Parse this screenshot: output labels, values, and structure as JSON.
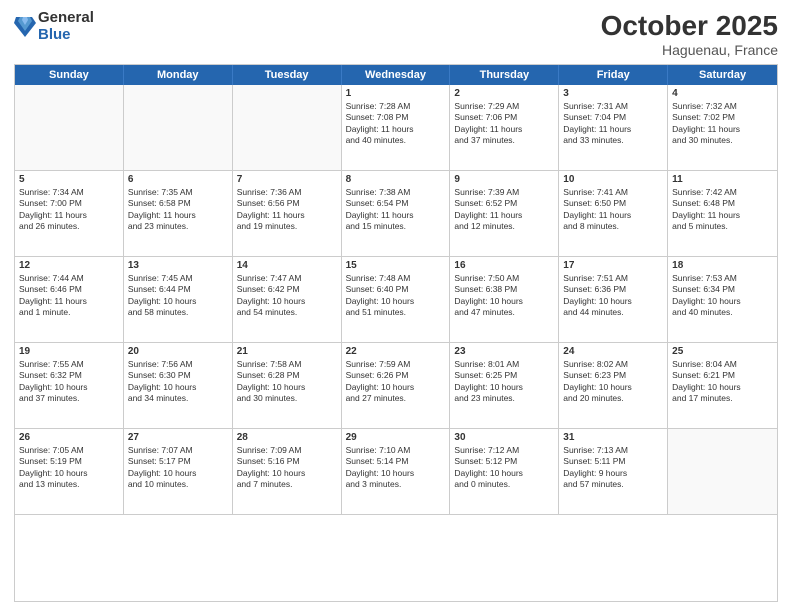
{
  "logo": {
    "general": "General",
    "blue": "Blue"
  },
  "title": "October 2025",
  "location": "Haguenau, France",
  "days": [
    "Sunday",
    "Monday",
    "Tuesday",
    "Wednesday",
    "Thursday",
    "Friday",
    "Saturday"
  ],
  "weeks": [
    [
      {
        "day": "",
        "data": []
      },
      {
        "day": "",
        "data": []
      },
      {
        "day": "",
        "data": []
      },
      {
        "day": "1",
        "data": [
          "Sunrise: 7:28 AM",
          "Sunset: 7:08 PM",
          "Daylight: 11 hours",
          "and 40 minutes."
        ]
      },
      {
        "day": "2",
        "data": [
          "Sunrise: 7:29 AM",
          "Sunset: 7:06 PM",
          "Daylight: 11 hours",
          "and 37 minutes."
        ]
      },
      {
        "day": "3",
        "data": [
          "Sunrise: 7:31 AM",
          "Sunset: 7:04 PM",
          "Daylight: 11 hours",
          "and 33 minutes."
        ]
      },
      {
        "day": "4",
        "data": [
          "Sunrise: 7:32 AM",
          "Sunset: 7:02 PM",
          "Daylight: 11 hours",
          "and 30 minutes."
        ]
      }
    ],
    [
      {
        "day": "5",
        "data": [
          "Sunrise: 7:34 AM",
          "Sunset: 7:00 PM",
          "Daylight: 11 hours",
          "and 26 minutes."
        ]
      },
      {
        "day": "6",
        "data": [
          "Sunrise: 7:35 AM",
          "Sunset: 6:58 PM",
          "Daylight: 11 hours",
          "and 23 minutes."
        ]
      },
      {
        "day": "7",
        "data": [
          "Sunrise: 7:36 AM",
          "Sunset: 6:56 PM",
          "Daylight: 11 hours",
          "and 19 minutes."
        ]
      },
      {
        "day": "8",
        "data": [
          "Sunrise: 7:38 AM",
          "Sunset: 6:54 PM",
          "Daylight: 11 hours",
          "and 15 minutes."
        ]
      },
      {
        "day": "9",
        "data": [
          "Sunrise: 7:39 AM",
          "Sunset: 6:52 PM",
          "Daylight: 11 hours",
          "and 12 minutes."
        ]
      },
      {
        "day": "10",
        "data": [
          "Sunrise: 7:41 AM",
          "Sunset: 6:50 PM",
          "Daylight: 11 hours",
          "and 8 minutes."
        ]
      },
      {
        "day": "11",
        "data": [
          "Sunrise: 7:42 AM",
          "Sunset: 6:48 PM",
          "Daylight: 11 hours",
          "and 5 minutes."
        ]
      }
    ],
    [
      {
        "day": "12",
        "data": [
          "Sunrise: 7:44 AM",
          "Sunset: 6:46 PM",
          "Daylight: 11 hours",
          "and 1 minute."
        ]
      },
      {
        "day": "13",
        "data": [
          "Sunrise: 7:45 AM",
          "Sunset: 6:44 PM",
          "Daylight: 10 hours",
          "and 58 minutes."
        ]
      },
      {
        "day": "14",
        "data": [
          "Sunrise: 7:47 AM",
          "Sunset: 6:42 PM",
          "Daylight: 10 hours",
          "and 54 minutes."
        ]
      },
      {
        "day": "15",
        "data": [
          "Sunrise: 7:48 AM",
          "Sunset: 6:40 PM",
          "Daylight: 10 hours",
          "and 51 minutes."
        ]
      },
      {
        "day": "16",
        "data": [
          "Sunrise: 7:50 AM",
          "Sunset: 6:38 PM",
          "Daylight: 10 hours",
          "and 47 minutes."
        ]
      },
      {
        "day": "17",
        "data": [
          "Sunrise: 7:51 AM",
          "Sunset: 6:36 PM",
          "Daylight: 10 hours",
          "and 44 minutes."
        ]
      },
      {
        "day": "18",
        "data": [
          "Sunrise: 7:53 AM",
          "Sunset: 6:34 PM",
          "Daylight: 10 hours",
          "and 40 minutes."
        ]
      }
    ],
    [
      {
        "day": "19",
        "data": [
          "Sunrise: 7:55 AM",
          "Sunset: 6:32 PM",
          "Daylight: 10 hours",
          "and 37 minutes."
        ]
      },
      {
        "day": "20",
        "data": [
          "Sunrise: 7:56 AM",
          "Sunset: 6:30 PM",
          "Daylight: 10 hours",
          "and 34 minutes."
        ]
      },
      {
        "day": "21",
        "data": [
          "Sunrise: 7:58 AM",
          "Sunset: 6:28 PM",
          "Daylight: 10 hours",
          "and 30 minutes."
        ]
      },
      {
        "day": "22",
        "data": [
          "Sunrise: 7:59 AM",
          "Sunset: 6:26 PM",
          "Daylight: 10 hours",
          "and 27 minutes."
        ]
      },
      {
        "day": "23",
        "data": [
          "Sunrise: 8:01 AM",
          "Sunset: 6:25 PM",
          "Daylight: 10 hours",
          "and 23 minutes."
        ]
      },
      {
        "day": "24",
        "data": [
          "Sunrise: 8:02 AM",
          "Sunset: 6:23 PM",
          "Daylight: 10 hours",
          "and 20 minutes."
        ]
      },
      {
        "day": "25",
        "data": [
          "Sunrise: 8:04 AM",
          "Sunset: 6:21 PM",
          "Daylight: 10 hours",
          "and 17 minutes."
        ]
      }
    ],
    [
      {
        "day": "26",
        "data": [
          "Sunrise: 7:05 AM",
          "Sunset: 5:19 PM",
          "Daylight: 10 hours",
          "and 13 minutes."
        ]
      },
      {
        "day": "27",
        "data": [
          "Sunrise: 7:07 AM",
          "Sunset: 5:17 PM",
          "Daylight: 10 hours",
          "and 10 minutes."
        ]
      },
      {
        "day": "28",
        "data": [
          "Sunrise: 7:09 AM",
          "Sunset: 5:16 PM",
          "Daylight: 10 hours",
          "and 7 minutes."
        ]
      },
      {
        "day": "29",
        "data": [
          "Sunrise: 7:10 AM",
          "Sunset: 5:14 PM",
          "Daylight: 10 hours",
          "and 3 minutes."
        ]
      },
      {
        "day": "30",
        "data": [
          "Sunrise: 7:12 AM",
          "Sunset: 5:12 PM",
          "Daylight: 10 hours",
          "and 0 minutes."
        ]
      },
      {
        "day": "31",
        "data": [
          "Sunrise: 7:13 AM",
          "Sunset: 5:11 PM",
          "Daylight: 9 hours",
          "and 57 minutes."
        ]
      },
      {
        "day": "",
        "data": []
      }
    ]
  ]
}
